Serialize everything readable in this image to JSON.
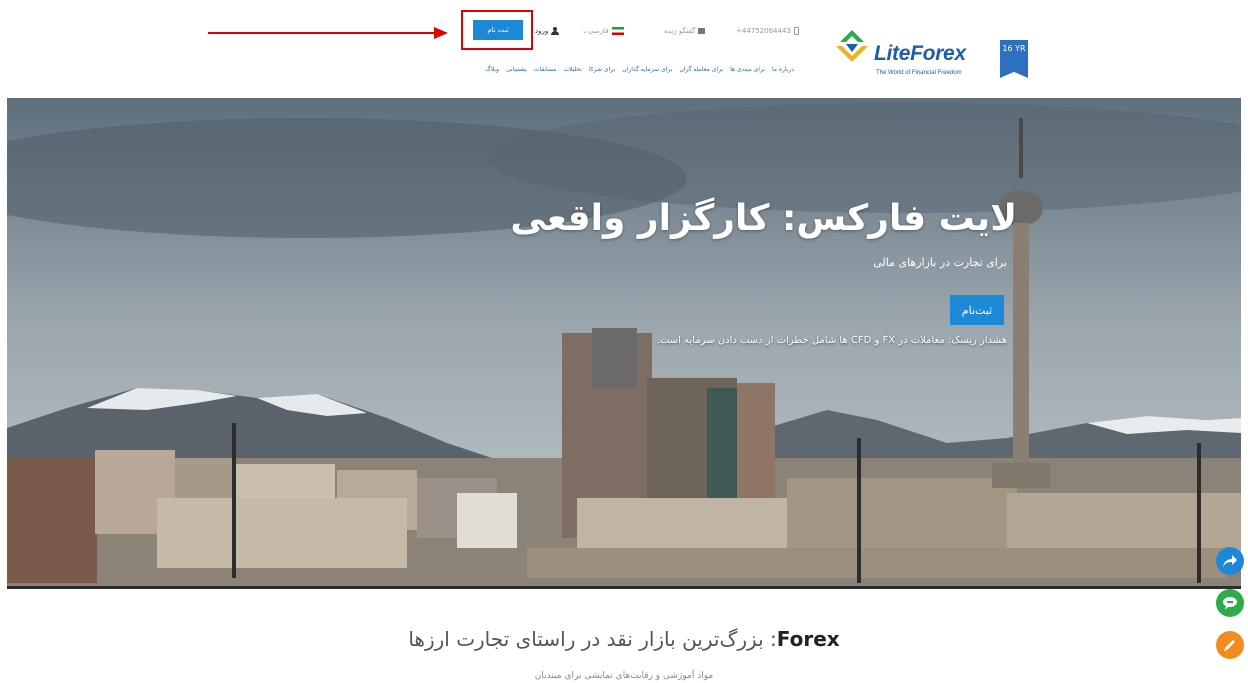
{
  "header": {
    "anniversary_badge": "16 YR",
    "logo_text": "LiteForex",
    "logo_tagline": "The World of Financial Freedom",
    "phone": "+44752064443",
    "chat_label": "گفتگو زنده",
    "language": "فارسی",
    "login_label": "ورود",
    "register_label": "ثبت نام",
    "nav_items": [
      "درباره ما",
      "برای مبتدی ها",
      "برای معامله گران",
      "برای سرمایه گذاران",
      "برای شرکا",
      "تحلیلات",
      "مسابقات",
      "پشتیبانی",
      "وبلاگ"
    ]
  },
  "hero": {
    "title": "لایت فارکس: کارگزار واقعی",
    "subtitle": "برای تجارت در بازارهای مالی",
    "button_label": "ثبت‌نام",
    "warning": "هشدار ریسک: معاملات در FX و CFD ها شامل خطرات از دست دادن سرمایه است."
  },
  "section": {
    "title_bold": "Forex",
    "title_rest": ": بزرگ‌ترین بازار نقد در راستای تجارت ارزها",
    "subtitle": "مواد آموزشی و رقابت‌های نمایشی برای مبتدیان"
  },
  "colors": {
    "accent": "#1e88d8",
    "annotation": "#e00000",
    "share": "#1e88d8",
    "chat": "#2eab4a",
    "edit": "#f28c1e"
  }
}
